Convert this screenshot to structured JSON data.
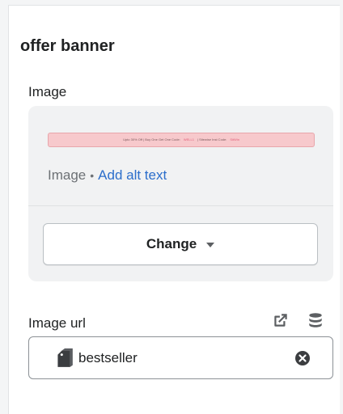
{
  "section": {
    "title": "offer banner"
  },
  "image_setting": {
    "label": "Image",
    "banner_preview": {
      "text": "Upto 30% Off | Buy One Get One Code:",
      "code1": "WELL1",
      "text2": "| Sitewise Inst Code:",
      "code2": "SitWin",
      "background_color": "#f7c9cc"
    },
    "meta_label": "Image",
    "separator": "•",
    "alt_text_link": "Add alt text",
    "change_button_label": "Change"
  },
  "image_url_setting": {
    "label": "Image url",
    "value": "bestseller",
    "icons": [
      "external-link-icon",
      "database-icon",
      "tag-icon",
      "clear-icon"
    ]
  },
  "colors": {
    "link": "#2c6ecb",
    "card_bg": "#f1f2f3",
    "text": "#202223",
    "subdued": "#6d7175"
  }
}
